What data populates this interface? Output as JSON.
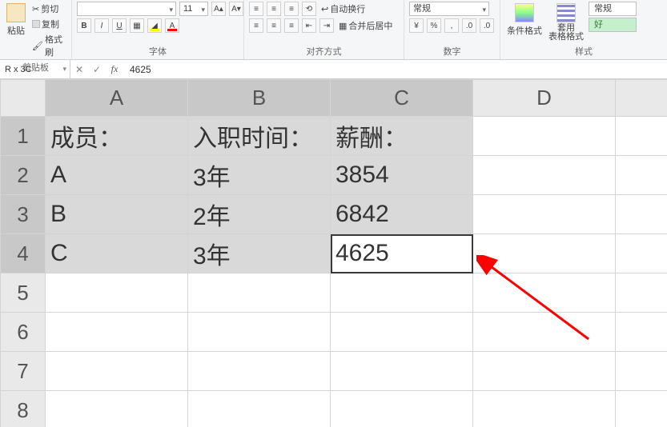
{
  "ribbon": {
    "clipboard": {
      "paste": "粘贴",
      "cut": "剪切",
      "copy": "复制",
      "format_painter": "格式刷",
      "group_label": "剪贴板"
    },
    "font": {
      "font_name": "",
      "font_size": "11",
      "bold": "B",
      "italic": "I",
      "underline": "U",
      "group_label": "字体"
    },
    "alignment": {
      "wrap_text": "自动换行",
      "merge_center": "合并后居中",
      "group_label": "对齐方式"
    },
    "number": {
      "format_name": "常规",
      "group_label": "数字"
    },
    "styles": {
      "conditional": "条件格式",
      "table_format": "套用\n表格格式",
      "cell_style_normal": "常规",
      "cell_style_good": "好",
      "group_label": "样式"
    }
  },
  "formula_bar": {
    "name_box": "R x 3C",
    "value": "4625"
  },
  "columns": [
    "A",
    "B",
    "C",
    "D"
  ],
  "rows": [
    "1",
    "2",
    "3",
    "4",
    "5",
    "6",
    "7",
    "8"
  ],
  "cells": {
    "A1": "成员：",
    "B1": "入职时间：",
    "C1": "薪酬：",
    "A2": "A",
    "B2": "3年",
    "C2": "3854",
    "A3": "B",
    "B3": "2年",
    "C3": "6842",
    "A4": "C",
    "B4": "3年",
    "C4": "4625"
  },
  "chart_data": {
    "type": "table",
    "headers": [
      "成员：",
      "入职时间：",
      "薪酬："
    ],
    "rows": [
      [
        "A",
        "3年",
        3854
      ],
      [
        "B",
        "2年",
        6842
      ],
      [
        "C",
        "3年",
        4625
      ]
    ]
  },
  "annotation": {
    "arrow_color": "#ff0000"
  }
}
